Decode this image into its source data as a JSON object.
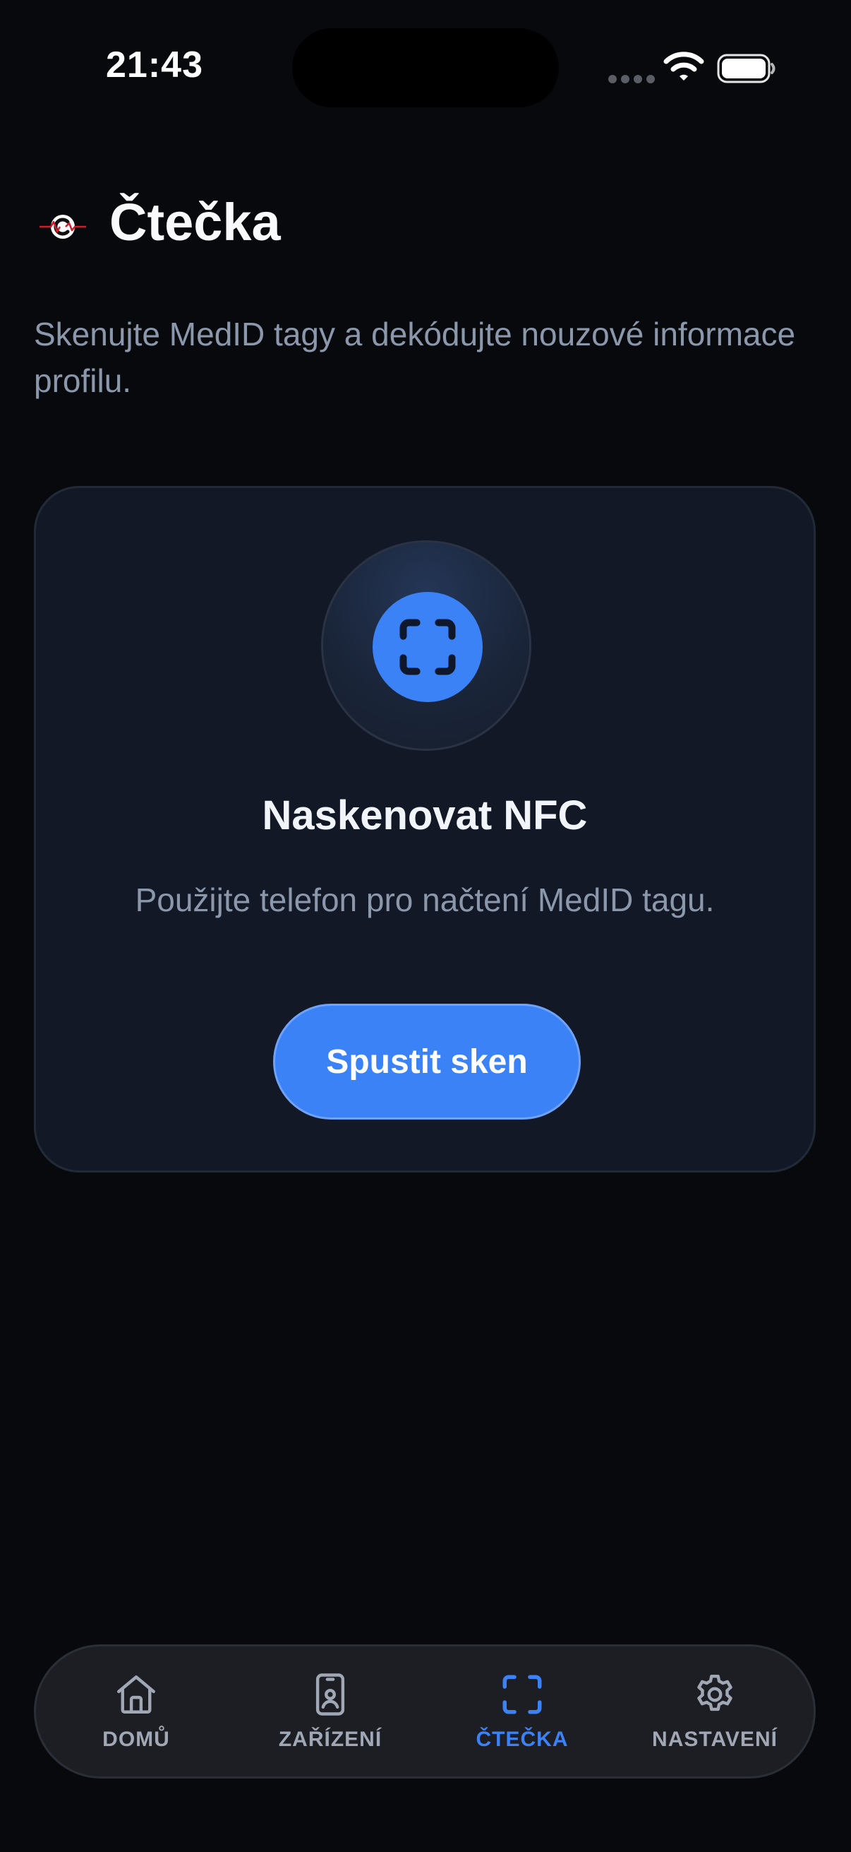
{
  "status_bar": {
    "time": "21:43"
  },
  "header": {
    "title": "Čtečka",
    "subtitle": "Skenujte MedID tagy a dekódujte nouzové informace profilu.",
    "logo_icon": "medid-logo-icon"
  },
  "scan_card": {
    "icon": "scan-frame-icon",
    "title": "Naskenovat NFC",
    "description": "Použijte telefon pro načtení MedID tagu.",
    "button_label": "Spustit sken"
  },
  "tab_bar": {
    "items": [
      {
        "label": "DOMŮ",
        "icon": "home-icon",
        "active": false
      },
      {
        "label": "ZAŘÍZENÍ",
        "icon": "device-icon",
        "active": false
      },
      {
        "label": "ČTEČKA",
        "icon": "scan-frame-icon",
        "active": true
      },
      {
        "label": "NASTAVENÍ",
        "icon": "gear-icon",
        "active": false
      }
    ]
  },
  "colors": {
    "background": "#08090d",
    "card": "#121826",
    "accent": "#3b82f6",
    "text_muted": "#8b97ab",
    "tab_bar": "#1c1e24"
  }
}
